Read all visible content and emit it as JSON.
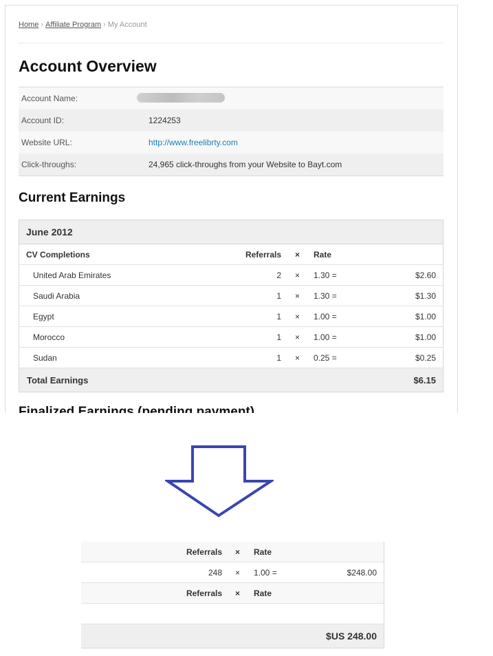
{
  "breadcrumb": {
    "home": "Home",
    "affiliate": "Affiliate Program",
    "current": "My Account",
    "sep": "›"
  },
  "overview": {
    "title": "Account Overview",
    "rows": [
      {
        "label": "Account Name:",
        "value": ""
      },
      {
        "label": "Account ID:",
        "value": "1224253"
      },
      {
        "label": "Website URL:",
        "value": "http://www.freelibrty.com"
      },
      {
        "label": "Click-throughs:",
        "value": "24,965 click-throughs from your Website to Bayt.com"
      }
    ]
  },
  "current": {
    "title": "Current Earnings",
    "month": "June 2012",
    "header": {
      "col1": "CV Completions",
      "col2": "Referrals",
      "col3": "×",
      "col4": "Rate"
    },
    "items": [
      {
        "country": "United Arab Emirates",
        "referrals": "2",
        "x": "×",
        "rate": "1.30 =",
        "amount": "$2.60"
      },
      {
        "country": "Saudi Arabia",
        "referrals": "1",
        "x": "×",
        "rate": "1.30 =",
        "amount": "$1.30"
      },
      {
        "country": "Egypt",
        "referrals": "1",
        "x": "×",
        "rate": "1.00 =",
        "amount": "$1.00"
      },
      {
        "country": "Morocco",
        "referrals": "1",
        "x": "×",
        "rate": "1.00 =",
        "amount": "$1.00"
      },
      {
        "country": "Sudan",
        "referrals": "1",
        "x": "×",
        "rate": "0.25 =",
        "amount": "$0.25"
      }
    ],
    "total_label": "Total Earnings",
    "total_value": "$6.15"
  },
  "finalized": {
    "title": "Finalized Earnings (pending payment)"
  },
  "arrow": {
    "color": "#3a45b0",
    "icon": "down-arrow-icon"
  },
  "detail": {
    "header1": {
      "col2": "Referrals",
      "col3": "×",
      "col4": "Rate"
    },
    "row": {
      "referrals": "248",
      "x": "×",
      "rate": "1.00 =",
      "amount": "$248.00"
    },
    "header2": {
      "col2": "Referrals",
      "col3": "×",
      "col4": "Rate"
    },
    "total": "$US 248.00"
  }
}
